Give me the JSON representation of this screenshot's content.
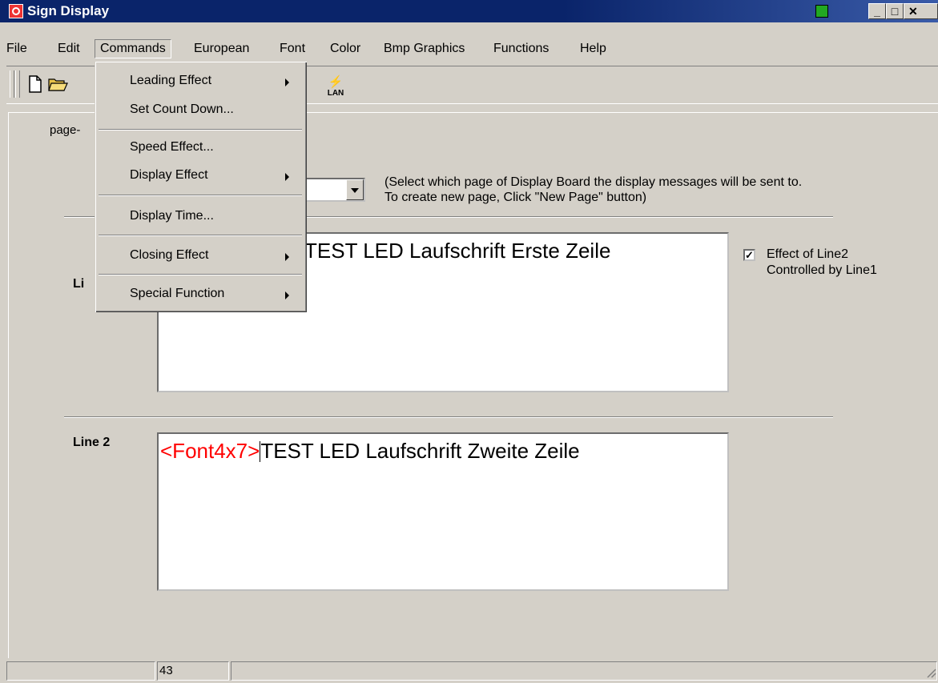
{
  "window": {
    "title": "Sign Display"
  },
  "menubar": {
    "items": [
      "File",
      "Edit",
      "Commands",
      "European",
      "Font",
      "Color",
      "Bmp Graphics",
      "Functions",
      "Help"
    ],
    "open_item": "Commands"
  },
  "commands_menu": {
    "items": [
      {
        "label": "Leading Effect",
        "submenu": true
      },
      {
        "label": "Set Count Down...",
        "submenu": false
      },
      {
        "label": "Speed Effect...",
        "submenu": false
      },
      {
        "label": "Display Effect",
        "submenu": true
      },
      {
        "label": "Display Time...",
        "submenu": false
      },
      {
        "label": "Closing Effect",
        "submenu": true
      },
      {
        "label": "Special Function",
        "submenu": true
      }
    ]
  },
  "toolbar": {
    "lan_label": "LAN"
  },
  "page_tab": {
    "label": "page-"
  },
  "page_select": {
    "value": "",
    "hint_line1": "(Select which page of Display Board the display messages will be sent to.",
    "hint_line2": "To create new page, Click \"New Page\" button)"
  },
  "line1": {
    "label": "Li",
    "text": "TEST LED Laufschrift Erste Zeile"
  },
  "line2": {
    "label": "Line 2",
    "tag": "<Font4x7>",
    "text": "TEST LED Laufschrift Zweite Zeile"
  },
  "effect_checkbox": {
    "checked": true,
    "label": "Effect of Line2 Controlled by Line1"
  },
  "statusbar": {
    "count": "43"
  },
  "colors": {
    "titlebar": "#0a246a",
    "tag_red": "#ff0000",
    "chrome": "#d4d0c8"
  }
}
